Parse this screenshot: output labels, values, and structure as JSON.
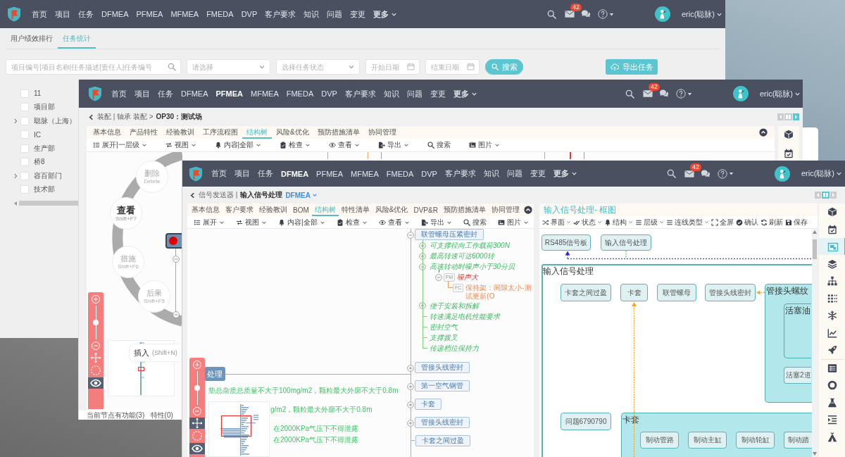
{
  "back_window": {
    "nav": {
      "items": [
        {
          "label": "首页",
          "selected": false
        },
        {
          "label": "项目",
          "selected": false
        },
        {
          "label": "任务",
          "selected": false
        },
        {
          "label": "DFMEA",
          "selected": false
        },
        {
          "label": "PFMEA",
          "selected": false
        },
        {
          "label": "MFMEA",
          "selected": false
        },
        {
          "label": "FMEDA",
          "selected": false
        },
        {
          "label": "DVP",
          "selected": false
        },
        {
          "label": "客户要求",
          "selected": false
        },
        {
          "label": "知识",
          "selected": false
        },
        {
          "label": "问题",
          "selected": false
        },
        {
          "label": "变更",
          "selected": false
        }
      ],
      "more": "更多",
      "badge": "42",
      "user": "eric(聪脉)"
    },
    "tabs": [
      {
        "label": "用户绩效排行",
        "selected": false
      },
      {
        "label": "任务统计",
        "selected": true
      }
    ],
    "filters": {
      "search": {
        "placeholder": "项目编号|项目名称|任务描述|责任人|任务编号"
      },
      "selects": [
        {
          "placeholder": "请选择"
        },
        {
          "placeholder": "选择任务状态"
        }
      ],
      "dates": [
        {
          "placeholder": "开始日期"
        },
        {
          "placeholder": "结束日期"
        }
      ],
      "search_button": "搜索",
      "export_button": "导出任务"
    },
    "tree": [
      {
        "label": "11",
        "checked": false,
        "expandable": false
      },
      {
        "label": "项目部",
        "checked": false,
        "expandable": false
      },
      {
        "label": "聪脉（上海）",
        "checked": false,
        "expandable": true
      },
      {
        "label": "IC",
        "checked": false,
        "expandable": false
      },
      {
        "label": "生产部",
        "checked": false,
        "expandable": false
      },
      {
        "label": "桥8",
        "checked": false,
        "expandable": false
      },
      {
        "label": "容百部门",
        "checked": false,
        "expandable": true
      },
      {
        "label": "技术部",
        "checked": false,
        "expandable": false
      }
    ]
  },
  "middle_window": {
    "nav": {
      "items": [
        {
          "label": "首页",
          "selected": false
        },
        {
          "label": "项目",
          "selected": false
        },
        {
          "label": "任务",
          "selected": false
        },
        {
          "label": "DFMEA",
          "selected": false
        },
        {
          "label": "PFMEA",
          "selected": true
        },
        {
          "label": "MFMEA",
          "selected": false
        },
        {
          "label": "FMEDA",
          "selected": false
        },
        {
          "label": "DVP",
          "selected": false
        },
        {
          "label": "客户要求",
          "selected": false
        },
        {
          "label": "知识",
          "selected": false
        },
        {
          "label": "问题",
          "selected": false
        },
        {
          "label": "变更",
          "selected": false
        }
      ],
      "more": "更多",
      "badge": "42",
      "user": "eric(聪脉)"
    },
    "breadcrumb": {
      "path": "装配 | 轴承 装配 >",
      "current": "OP30：测试场"
    },
    "layout_buttons": [
      {
        "selected": false
      },
      {
        "selected": false
      },
      {
        "selected": true
      }
    ],
    "tabs": [
      {
        "label": "基本信息",
        "selected": false
      },
      {
        "label": "产品特性",
        "selected": false
      },
      {
        "label": "经验教训",
        "selected": false
      },
      {
        "label": "工序流程图",
        "selected": false
      },
      {
        "label": "结构树",
        "selected": true
      },
      {
        "label": "风险&优化",
        "selected": false
      },
      {
        "label": "预防措施清单",
        "selected": false
      },
      {
        "label": "协同管理",
        "selected": false
      }
    ],
    "toolbar": [
      {
        "label": "展开|一层级",
        "dropdown": true
      },
      {
        "label": "视图",
        "dropdown": true
      },
      {
        "label": "内容|全部",
        "dropdown": true
      },
      {
        "label": "检查",
        "dropdown": true
      },
      {
        "label": "查看",
        "dropdown": true
      },
      {
        "label": "导出",
        "dropdown": true
      },
      {
        "label": "搜索",
        "dropdown": false
      },
      {
        "label": "图片",
        "dropdown": true
      }
    ],
    "radial_menu": [
      {
        "label": "删除",
        "shortcut": "Delete",
        "selected": false
      },
      {
        "label": "查看",
        "shortcut": "Shift+F7",
        "selected": true
      },
      {
        "label": "措施",
        "shortcut": "Shift+F6",
        "selected": false
      },
      {
        "label": "后果",
        "shortcut": "Shift+F5",
        "selected": false
      }
    ],
    "zoom": {
      "level": 0.5,
      "tools": [
        {
          "selected": false
        },
        {
          "selected": false
        },
        {
          "selected": true
        }
      ]
    },
    "tooltip": {
      "label": "插入",
      "shortcut": "(Shift+N)"
    },
    "status": "当前节点有功能(3)   特性(0)"
  },
  "front_window": {
    "nav": {
      "items": [
        {
          "label": "首页",
          "selected": false
        },
        {
          "label": "项目",
          "selected": false
        },
        {
          "label": "任务",
          "selected": false
        },
        {
          "label": "DFMEA",
          "selected": true
        },
        {
          "label": "PFMEA",
          "selected": false
        },
        {
          "label": "MFMEA",
          "selected": false
        },
        {
          "label": "FMEDA",
          "selected": false
        },
        {
          "label": "DVP",
          "selected": false
        },
        {
          "label": "客户要求",
          "selected": false
        },
        {
          "label": "知识",
          "selected": false
        },
        {
          "label": "问题",
          "selected": false
        },
        {
          "label": "变更",
          "selected": false
        }
      ],
      "more": "更多",
      "badge": "42",
      "user": "eric(聪脉)"
    },
    "breadcrumb": {
      "path": "信号发送器 |",
      "current": "输入信号处理",
      "mode": "DFMEA"
    },
    "layout_buttons": [
      {
        "selected": false
      },
      {
        "selected": true
      },
      {
        "selected": false
      }
    ],
    "tabs": [
      {
        "label": "基本信息",
        "selected": false
      },
      {
        "label": "客户要求",
        "selected": false
      },
      {
        "label": "经验教训",
        "selected": false
      },
      {
        "label": "BOM",
        "selected": false
      },
      {
        "label": "结构树",
        "selected": true
      },
      {
        "label": "特性清单",
        "selected": false
      },
      {
        "label": "风险&优化",
        "selected": false
      },
      {
        "label": "DVP&R",
        "selected": false
      },
      {
        "label": "预防措施清单",
        "selected": false
      },
      {
        "label": "协同管理",
        "selected": false
      }
    ],
    "toolbar": [
      {
        "label": "展开",
        "dropdown": true
      },
      {
        "label": "视图",
        "dropdown": true
      },
      {
        "label": "内容|全部",
        "dropdown": true
      },
      {
        "label": "检查",
        "dropdown": true
      },
      {
        "label": "查看",
        "dropdown": true
      },
      {
        "label": "导出",
        "dropdown": true
      },
      {
        "label": "搜索",
        "dropdown": false
      },
      {
        "label": "图片",
        "dropdown": true
      }
    ],
    "mind_map": {
      "root": "处理",
      "notes": [
        "垫总杂质总质量不大于100mg/m2，颗粒最大外廓不大于0.8m",
        "g/m2，颗粒最大外廓不大于0.8m",
        "在2000KPa气压下不得泄露",
        "在2000KPa气压下不得泄露"
      ],
      "branches": [
        {
          "label": "联管螺母压紧密封",
          "expanded": true,
          "children": [
            {
              "label": "可支撑径向工作载荷300N",
              "expanded": false
            },
            {
              "label": "最高转速可达6000转",
              "expanded": false
            },
            {
              "label": "高速转动时噪声小于30分贝",
              "expanded": true,
              "children": [
                {
                  "tag": "FM",
                  "label": "噪声大",
                  "expanded": true,
                  "children": [
                    {
                      "tag": "FC",
                      "label": "保持架：间隙太小-测试更新(O"
                    }
                  ]
                }
              ]
            },
            {
              "label": "便于安装和拆解",
              "expanded": false
            },
            {
              "label": "转速满足电机性能要求"
            },
            {
              "label": "密封空气"
            },
            {
              "label": "支撑拨叉"
            },
            {
              "label": "传递档位保持力"
            }
          ]
        },
        {
          "label": "管接头线密封",
          "expanded": false
        },
        {
          "label": "第一空气钢管",
          "expanded": false
        },
        {
          "label": "卡套",
          "expanded": false
        },
        {
          "label": "管接头线密封",
          "expanded": false
        },
        {
          "label": "卡套之间过盈"
        }
      ]
    },
    "zoom": {
      "level": 0.5,
      "tools": [
        {
          "selected": true
        },
        {
          "selected": false
        },
        {
          "selected": true
        }
      ]
    },
    "diagram": {
      "title": "输入信号处理- 框图",
      "toolbar": [
        {
          "label": "界面",
          "dropdown": true
        },
        {
          "label": "状态",
          "dropdown": true
        },
        {
          "label": "结构",
          "dropdown": true
        },
        {
          "label": "层级",
          "dropdown": true
        },
        {
          "label": "连线类型",
          "dropdown": true
        },
        {
          "label": "全屏",
          "dropdown": false
        },
        {
          "label": "确认",
          "dropdown": false
        },
        {
          "label": "刷新",
          "dropdown": false
        },
        {
          "label": "保存",
          "dropdown": false
        }
      ],
      "nodes": [
        "RS485信号板",
        "输入信号处理"
      ],
      "frame": {
        "title": "输入信号处理",
        "nodes": [
          "卡套之间过盈",
          "卡套",
          "联管螺母",
          "管接头线密封",
          "问题6790790"
        ],
        "groups": [
          {
            "title": "管接头螺纹",
            "groups": [
              {
                "title": "活塞油"
              }
            ],
            "nodes": [
              "活塞2道"
            ]
          },
          {
            "title": "卡套",
            "nodes": [
              "制动管路",
              "制动主缸",
              "制动轮缸",
              "制动踏"
            ]
          }
        ]
      }
    },
    "side_icons": [
      {
        "selected": false
      },
      {
        "selected": false
      },
      {
        "selected": true
      },
      {
        "selected": false
      },
      {
        "selected": false
      },
      {
        "selected": false
      },
      {
        "selected": false
      },
      {
        "selected": false
      },
      {
        "selected": false
      },
      {
        "selected": false
      },
      {
        "selected": false
      },
      {
        "selected": false
      },
      {
        "selected": false
      },
      {
        "selected": false
      }
    ]
  }
}
